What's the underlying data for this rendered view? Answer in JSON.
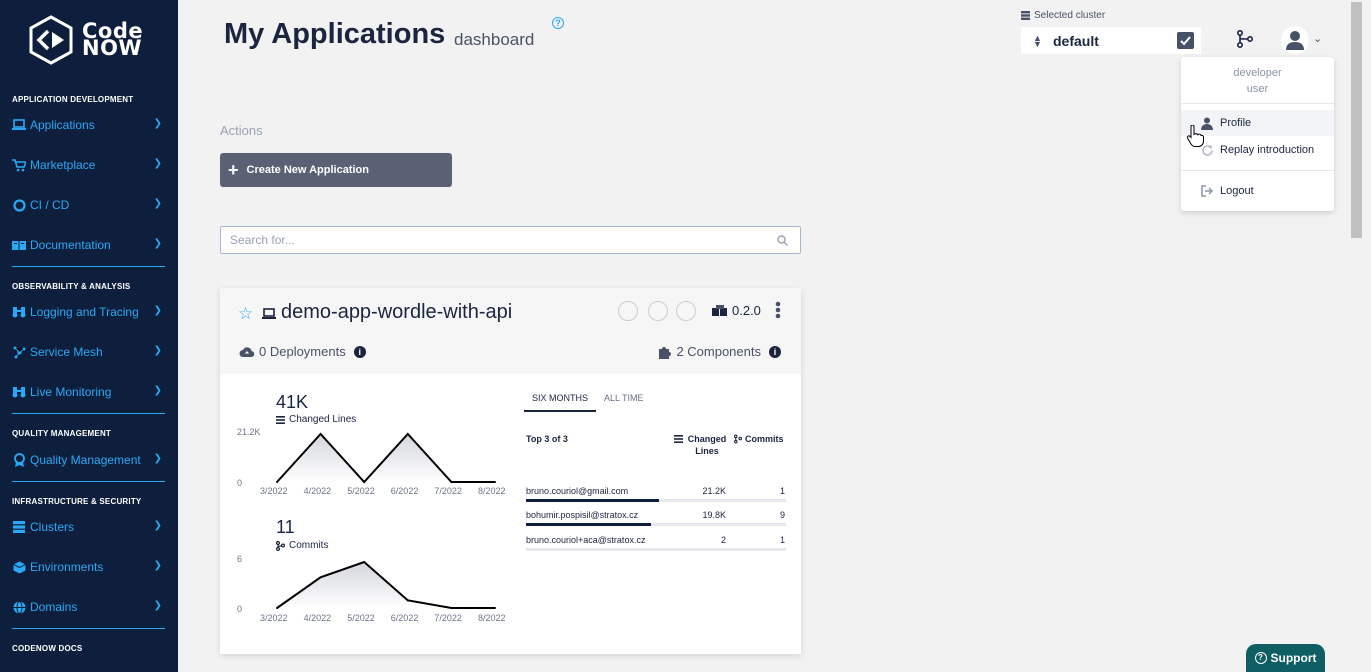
{
  "brand": {
    "line1": "Code",
    "line2": "NOW"
  },
  "sidebar": {
    "sections": [
      {
        "title": "APPLICATION DEVELOPMENT"
      },
      {
        "title": "OBSERVABILITY & ANALYSIS"
      },
      {
        "title": "QUALITY MANAGEMENT"
      },
      {
        "title": "INFRASTRUCTURE & SECURITY"
      },
      {
        "title": "CODENOW DOCS"
      }
    ],
    "items": [
      {
        "label": "Applications",
        "icon": "laptop-icon"
      },
      {
        "label": "Marketplace",
        "icon": "cart-icon"
      },
      {
        "label": "CI / CD",
        "icon": "cicd-icon"
      },
      {
        "label": "Documentation",
        "icon": "book-icon"
      },
      {
        "label": "Logging and Tracing",
        "icon": "binoculars-icon"
      },
      {
        "label": "Service Mesh",
        "icon": "mesh-icon"
      },
      {
        "label": "Live Monitoring",
        "icon": "binoculars-icon"
      },
      {
        "label": "Quality Management",
        "icon": "quality-icon"
      },
      {
        "label": "Clusters",
        "icon": "server-icon"
      },
      {
        "label": "Environments",
        "icon": "cube-icon"
      },
      {
        "label": "Domains",
        "icon": "globe-icon"
      }
    ]
  },
  "header": {
    "title": "My Applications",
    "subtitle": "dashboard",
    "help": "?",
    "cluster_label": "Selected cluster",
    "cluster_value": "default"
  },
  "user_menu": {
    "name_line1": "developer",
    "name_line2": "user",
    "items": [
      {
        "label": "Profile",
        "icon": "user-icon"
      },
      {
        "label": "Replay introduction",
        "icon": "refresh-icon"
      },
      {
        "label": "Logout",
        "icon": "logout-icon"
      }
    ]
  },
  "actions": {
    "label": "Actions",
    "create_label": "Create New Application"
  },
  "search": {
    "placeholder": "Search for..."
  },
  "app": {
    "name": "demo-app-wordle-with-api",
    "version": "0.2.0",
    "deployments": "0 Deployments",
    "components": "2 Components",
    "info": "i",
    "changed_lines": {
      "total": "41K",
      "label": "Changed Lines",
      "y_max_label": "21.2K",
      "y_min_label": "0"
    },
    "commits": {
      "total": "11",
      "label": "Commits",
      "y_max_label": "6",
      "y_min_label": "0"
    },
    "tabs": [
      {
        "label": "SIX MONTHS"
      },
      {
        "label": "ALL TIME"
      }
    ],
    "top_label": "Top 3 of 3",
    "col_changed": "Changed Lines",
    "col_commits": "Commits",
    "contributors": [
      {
        "email": "bruno.couriol@gmail.com",
        "lines": "21.2K",
        "commits": "1",
        "share": 0.51
      },
      {
        "email": "bohumir.pospisil@stratox.cz",
        "lines": "19.8K",
        "commits": "9",
        "share": 0.48
      },
      {
        "email": "bruno.couriol+aca@stratox.cz",
        "lines": "2",
        "commits": "1",
        "share": 0.0
      }
    ]
  },
  "chart_data": [
    {
      "type": "area",
      "series": [
        {
          "name": "Changed Lines",
          "values": [
            0,
            21200,
            0,
            21200,
            0,
            0
          ]
        }
      ],
      "categories": [
        "3/2022",
        "4/2022",
        "5/2022",
        "6/2022",
        "7/2022",
        "8/2022"
      ],
      "ylim": [
        0,
        21200
      ]
    },
    {
      "type": "area",
      "series": [
        {
          "name": "Commits",
          "values": [
            0,
            4,
            6,
            1,
            0,
            0
          ]
        }
      ],
      "categories": [
        "3/2022",
        "4/2022",
        "5/2022",
        "6/2022",
        "7/2022",
        "8/2022"
      ],
      "ylim": [
        0,
        6
      ]
    }
  ],
  "support": {
    "label": "Support"
  }
}
